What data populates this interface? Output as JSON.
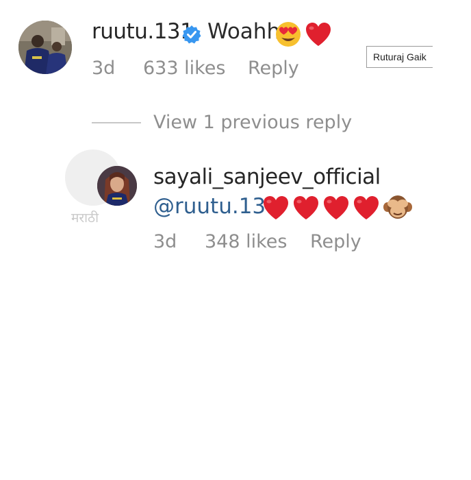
{
  "comment": {
    "username": "ruutu.131",
    "text": "Woahh",
    "time": "3d",
    "likes": "633 likes",
    "reply_label": "Reply",
    "verified": true
  },
  "tooltip": {
    "text": "Ruturaj Gaik"
  },
  "view_previous": "View 1 previous reply",
  "reply": {
    "username": "sayali_sanjeev_official",
    "mention": "@ruutu.131",
    "time": "3d",
    "likes": "348 likes",
    "reply_label": "Reply"
  },
  "watermark_text": "मराठी",
  "icons": {
    "verified": "verified-badge-icon",
    "heart_eyes": "heart-eyes-emoji-icon",
    "heart": "red-heart-emoji-icon",
    "monkey": "see-no-evil-monkey-emoji-icon"
  },
  "colors": {
    "heart": "#e0202e",
    "verified": "#3897f0",
    "meta": "#8e8e8e",
    "mention": "#2f5f8f"
  }
}
